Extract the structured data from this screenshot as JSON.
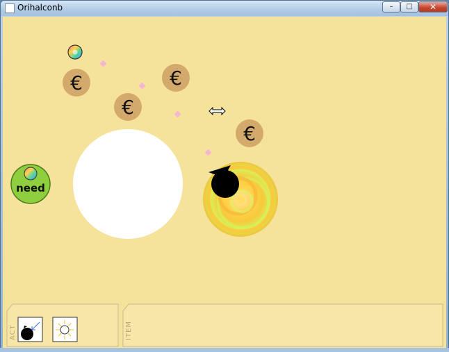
{
  "window": {
    "title": "Orihalconb",
    "buttons": {
      "minimize": "–",
      "maximize": "□",
      "close": "✕"
    }
  },
  "scene": {
    "background_color": "#f5e39c",
    "coin_symbol": "€",
    "coin_color": "#d4a96c",
    "need_label": "need",
    "need_color": "#8fce3e"
  },
  "panels": {
    "act_label": "ACT",
    "item_label": "ITEM",
    "act_items": [
      {
        "name": "player-move-action",
        "icon": "black-ball-arrow-icon"
      },
      {
        "name": "light-action",
        "icon": "sun-icon"
      }
    ]
  }
}
